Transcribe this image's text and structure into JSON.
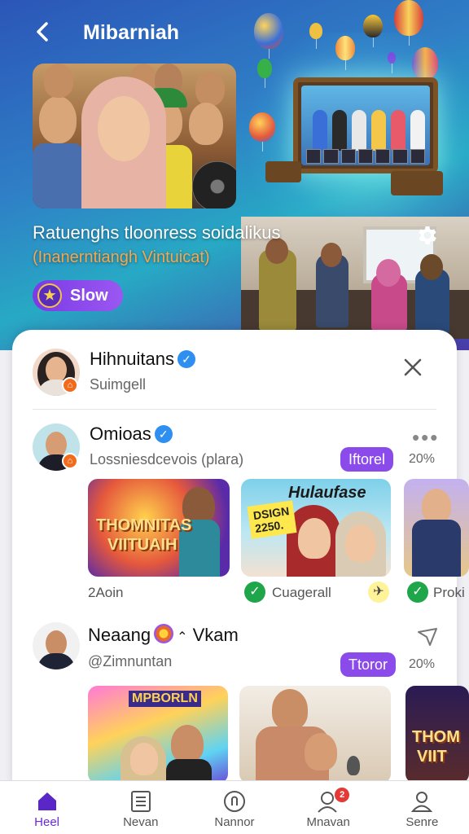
{
  "header": {
    "title": "Mibarniah",
    "back_icon": "chevron-left-icon"
  },
  "hero": {
    "headline": "Ratuenghs tloonress soidalikus",
    "subheadline": "(Inanernt­iangh Vintuicat)",
    "pill_label": "Slow",
    "pill_icon": "star-icon",
    "settings_icon": "gear-icon"
  },
  "posts": [
    {
      "name": "Hihnuitans",
      "handle": "Suimgell",
      "verified": true,
      "close_label": "×"
    },
    {
      "name": "Omioas",
      "handle": "Lossniesdcevois (plara)",
      "verified": true,
      "tag": "Iftorel",
      "percent": "20%",
      "more_label": "•••",
      "thumbnails": [
        {
          "title_line1": "THOMNITAS",
          "title_line2": "VIITUAIH"
        },
        {
          "banner": "Hulaufase",
          "sign_line1": "DSIGN",
          "sign_line2": "2250."
        },
        {
          "banner": ""
        }
      ],
      "captions": [
        {
          "text": "2Aoin"
        },
        {
          "text": "Cuagerall",
          "icon": "check-icon"
        },
        {
          "text": "Proki",
          "icon": "check-icon"
        }
      ],
      "plane_icon": "airplane-icon"
    },
    {
      "name": "Neaang",
      "name_suffix": "Vkam",
      "emoji_icon": "flower-emoji-icon",
      "handle": "@Zimnuntan",
      "tag": "Ttoror",
      "percent": "20%",
      "share_icon": "share-arrow-icon",
      "thumbnails": [
        {
          "banner": "MPBORLN"
        },
        {
          "banner": ""
        },
        {
          "title_line1": "THOM",
          "title_line2": "VIIT"
        }
      ]
    }
  ],
  "bottom_nav": [
    {
      "label": "Heel",
      "icon": "home-icon",
      "active": true
    },
    {
      "label": "Nevan",
      "icon": "list-icon"
    },
    {
      "label": "Nannor",
      "icon": "mic-circle-icon"
    },
    {
      "label": "Mnavan",
      "icon": "person-search-icon",
      "badge": "2"
    },
    {
      "label": "Senre",
      "icon": "user-icon"
    }
  ],
  "colors": {
    "accent": "#8a4bea",
    "active_nav": "#6a2bd6",
    "verified": "#2f8ff0",
    "check": "#1fa54a",
    "badge": "#e53935",
    "hero_subtitle": "#f6a64c"
  }
}
